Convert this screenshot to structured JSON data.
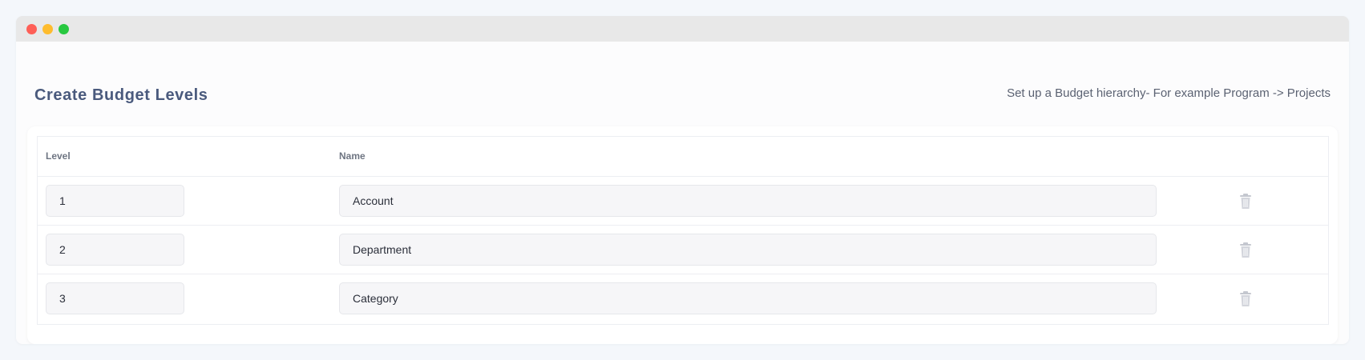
{
  "page": {
    "title": "Create Budget Levels",
    "hint": "Set up a Budget hierarchy- For example Program -> Projects"
  },
  "table": {
    "columns": {
      "level": "Level",
      "name": "Name"
    },
    "rows": [
      {
        "level": "1",
        "name": "Account"
      },
      {
        "level": "2",
        "name": "Department"
      },
      {
        "level": "3",
        "name": "Category"
      }
    ],
    "row_action_icon": "trash-icon"
  },
  "colors": {
    "title": "#4a5a7d",
    "field_bg": "#f6f6f8",
    "icon": "#c4c7cf"
  }
}
